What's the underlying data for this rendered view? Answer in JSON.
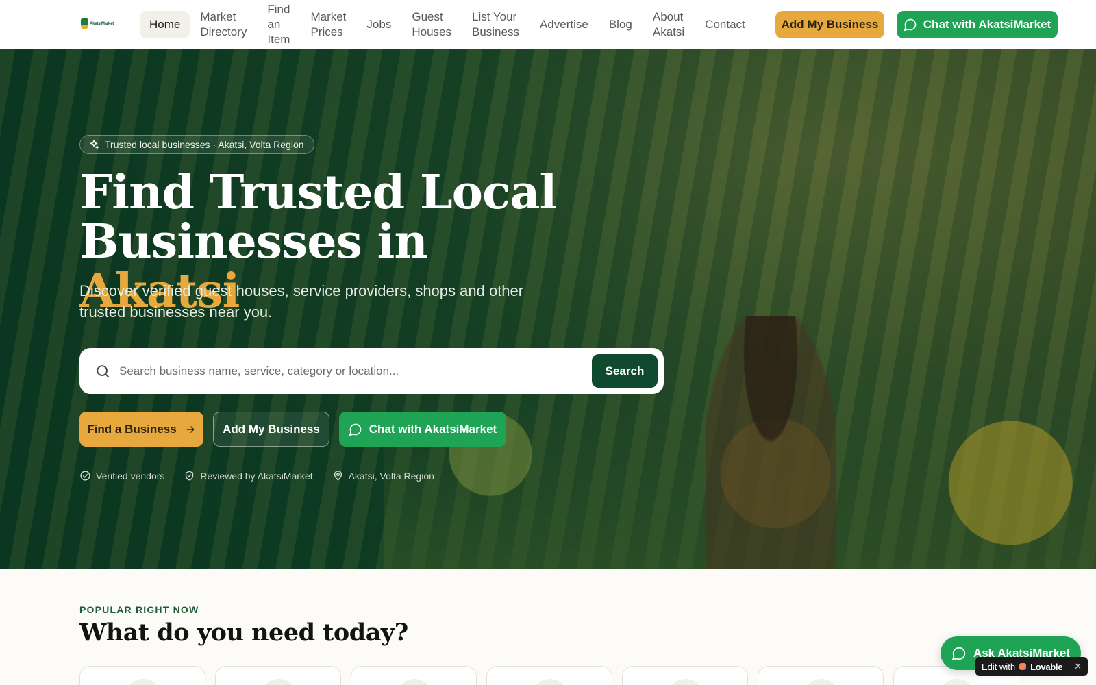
{
  "brand": {
    "logo_text": "AkatsiMarket"
  },
  "nav": {
    "items": [
      {
        "label": "Home",
        "active": true
      },
      {
        "label": "Market\nDirectory"
      },
      {
        "label": "Find\nan\nItem"
      },
      {
        "label": "Market\nPrices"
      },
      {
        "label": "Jobs"
      },
      {
        "label": "Guest\nHouses"
      },
      {
        "label": "List Your\nBusiness"
      },
      {
        "label": "Advertise"
      },
      {
        "label": "Blog"
      },
      {
        "label": "About\nAkatsi"
      },
      {
        "label": "Contact"
      }
    ],
    "add_business": "Add My Business",
    "chat": "Chat with AkatsiMarket"
  },
  "hero": {
    "badge": "Trusted local businesses · Akatsi, Volta Region",
    "title_line1": "Find Trusted Local",
    "title_line2": "Businesses in ",
    "title_accent": "Akatsi",
    "subtitle": "Discover verified guest houses, service providers, shops and other trusted businesses near you.",
    "search": {
      "placeholder": "Search business name, service, category or location...",
      "value": "",
      "button": "Search"
    },
    "actions": {
      "find": "Find a Business",
      "add": "Add My Business",
      "chat": "Chat with AkatsiMarket"
    },
    "trust": [
      {
        "icon": "check-circle-icon",
        "label": "Verified vendors"
      },
      {
        "icon": "shield-check-icon",
        "label": "Reviewed by AkatsiMarket"
      },
      {
        "icon": "map-pin-icon",
        "label": "Akatsi, Volta Region"
      }
    ]
  },
  "popular": {
    "eyebrow": "POPULAR RIGHT NOW",
    "title": "What do you need today?"
  },
  "floating": {
    "ask": "Ask AkatsiMarket",
    "edit_with": "Edit with",
    "lovable": "Lovable",
    "close": "✕"
  },
  "colors": {
    "brand_green": "#0f4a2e",
    "whatsapp_green": "#1fa456",
    "accent_gold": "#e7a93d",
    "hero_overlay": "#0a3a23"
  }
}
